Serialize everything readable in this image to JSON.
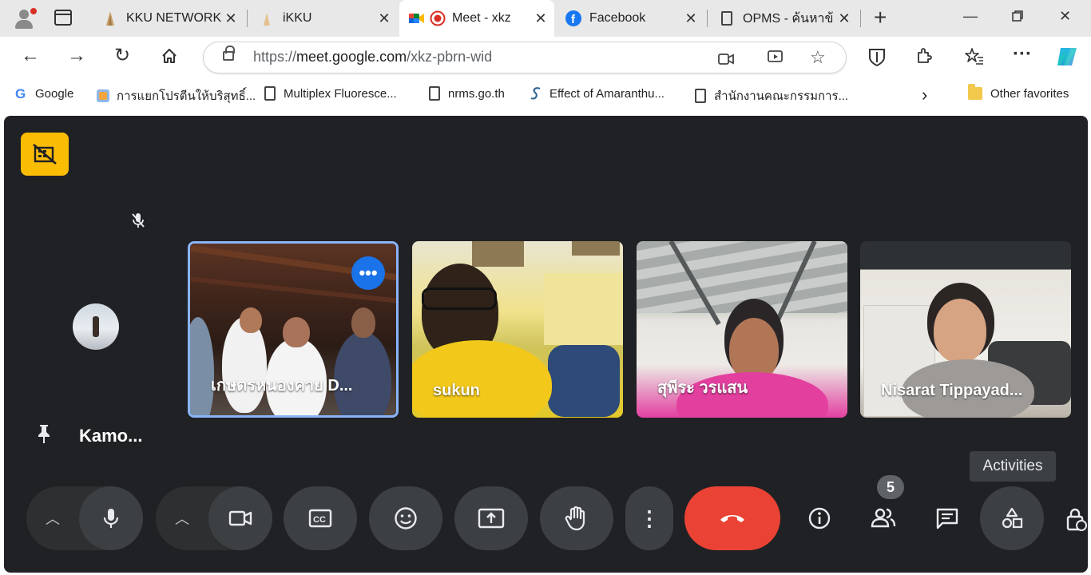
{
  "browser": {
    "tabs": [
      {
        "title": "KKU NETWORK",
        "favicon": "kku-logo-icon",
        "active": false
      },
      {
        "title": "iKKU",
        "favicon": "kku-logo-icon",
        "active": false
      },
      {
        "title": "Meet - xkz",
        "favicon": "google-meet-icon",
        "active": true,
        "recording": true
      },
      {
        "title": "Facebook",
        "favicon": "facebook-icon",
        "active": false
      },
      {
        "title": "OPMS - ค้นหาข้",
        "favicon": "document-icon",
        "active": false
      }
    ],
    "close_glyph": "✕",
    "url_prefix": "https://",
    "url_host": "meet.google.com",
    "url_path": "/xkz-pbrn-wid",
    "favorites": [
      {
        "label": "Google",
        "icon": "google-icon"
      },
      {
        "label": "การแยกโปรตีนให้บริสุทธิ์...",
        "icon": "site-icon"
      },
      {
        "label": "Multiplex Fluoresce...",
        "icon": "document-icon"
      },
      {
        "label": "nrms.go.th",
        "icon": "document-icon"
      },
      {
        "label": "Effect of Amaranthu...",
        "icon": "springer-icon"
      },
      {
        "label": "สำนักงานคณะกรรมการ...",
        "icon": "document-icon"
      }
    ],
    "other_favorites": "Other favorites"
  },
  "meet": {
    "pinned_participant": "Kamo...",
    "participants": [
      {
        "name": "เกษตรหนองคาย D...",
        "selected": true
      },
      {
        "name": "sukun",
        "selected": false
      },
      {
        "name": "สุพีระ วรแสน",
        "selected": false
      },
      {
        "name": "Nisarat Tippayad...",
        "selected": false
      }
    ],
    "people_count": "5",
    "tooltip": "Activities",
    "colors": {
      "surface": "#202124",
      "control": "#3c4043",
      "end_call": "#ea4335",
      "highlight": "#8ab4f8",
      "badge": "#fbbc04"
    }
  }
}
